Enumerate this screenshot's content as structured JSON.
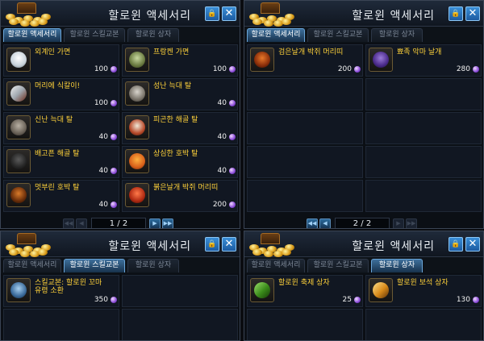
{
  "colors": {
    "item_name": "#ffd23a",
    "active_tab": "#3d6f9c",
    "price": "#f0f0f0"
  },
  "panels": [
    {
      "title": "할로윈 액세서리",
      "tabs": [
        "할로윈 액세서리",
        "할로윈 스킬교본",
        "할로윈 상자"
      ],
      "active_tab": 0,
      "items": [
        {
          "name": "외계인 가면",
          "name2": "",
          "price": "100",
          "icon": "alien-mask-icon"
        },
        {
          "name": "프랑켄 가면",
          "name2": "",
          "price": "100",
          "icon": "frankenstein-mask-icon"
        },
        {
          "name": "머리에 식칼이!",
          "name2": "",
          "price": "100",
          "icon": "knife-headband-icon"
        },
        {
          "name": "성난 늑대 탈",
          "name2": "",
          "price": "40",
          "icon": "angry-wolf-mask-icon"
        },
        {
          "name": "신난 늑대 탈",
          "name2": "",
          "price": "40",
          "icon": "happy-wolf-mask-icon"
        },
        {
          "name": "피곤한 해골 탈",
          "name2": "",
          "price": "40",
          "icon": "tired-skull-mask-icon"
        },
        {
          "name": "배고픈 해골 탈",
          "name2": "",
          "price": "40",
          "icon": "hungry-skull-mask-icon"
        },
        {
          "name": "상심한 호박 탈",
          "name2": "",
          "price": "40",
          "icon": "sad-pumpkin-mask-icon"
        },
        {
          "name": "멋부린 호박 탈",
          "name2": "",
          "price": "40",
          "icon": "fancy-pumpkin-mask-icon"
        },
        {
          "name": "붉은날개 박쥐 머리띠",
          "name2": "",
          "price": "200",
          "icon": "red-bat-headband-icon"
        }
      ],
      "pager": {
        "page": "1 / 2",
        "prev_first": "◀◀",
        "prev": "◀",
        "next": "▶",
        "next_last": "▶▶"
      }
    },
    {
      "title": "할로윈 액세서리",
      "tabs": [
        "할로윈 액세서리",
        "할로윈 스킬교본",
        "할로윈 상자"
      ],
      "active_tab": 0,
      "items": [
        {
          "name": "검은날개 박쥐 머리띠",
          "name2": "",
          "price": "200",
          "icon": "black-bat-headband-icon"
        },
        {
          "name": "뾰족 악마 날개",
          "name2": "",
          "price": "280",
          "icon": "devil-wings-icon"
        }
      ],
      "pager": {
        "page": "2 / 2",
        "prev_first": "◀◀",
        "prev": "◀",
        "next": "▶",
        "next_last": "▶▶"
      }
    },
    {
      "title": "할로윈 액세서리",
      "tabs": [
        "할로윈 액세서리",
        "할로윈 스킬교본",
        "할로윈 상자"
      ],
      "active_tab": 1,
      "items": [
        {
          "name": "스킬교본: 할로윈 꼬마",
          "name2": "유령 소환",
          "price": "350",
          "icon": "skill-book-icon"
        }
      ]
    },
    {
      "title": "할로윈 액세서리",
      "tabs": [
        "할로윈 액세서리",
        "할로윈 스킬교본",
        "할로윈 상자"
      ],
      "active_tab": 2,
      "items": [
        {
          "name": "할로윈 축제 상자",
          "name2": "",
          "price": "25",
          "icon": "festival-box-icon"
        },
        {
          "name": "할로윈 보석 상자",
          "name2": "",
          "price": "130",
          "icon": "jewel-box-icon"
        }
      ]
    }
  ]
}
